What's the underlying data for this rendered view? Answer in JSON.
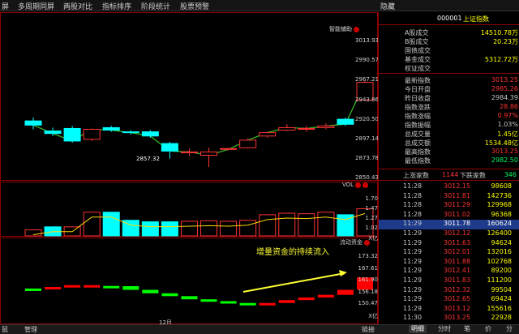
{
  "menu": [
    "屏",
    "多周期同屏",
    "两股对比",
    "指标排序",
    "阶段统计",
    "股票预警"
  ],
  "menu_right": "隐藏",
  "price_axis": [
    "3013.93",
    "2990.57",
    "2967.21",
    "2943.86",
    "2920.50",
    "2897.14",
    "2873.78",
    "2850.43"
  ],
  "low_label": "2857.32",
  "price_panel_title": "智能辅助",
  "vol_panel_title": "VOL",
  "vol_axis": [
    "1.70",
    "1.47",
    "1.27",
    "1.02",
    "X亿"
  ],
  "flow_panel_title": "流动资金",
  "flow_axis": [
    "173.32",
    "167.61",
    "161.90",
    "156.18",
    "150.47",
    "X亿"
  ],
  "annotation": "增量资金的持续流入",
  "x_label": "12月",
  "bottom_tabs": [
    "鼠",
    "管理"
  ],
  "right_tail": "链接",
  "stock_code": "000001",
  "stock_name": "上证指数",
  "info1": [
    {
      "label": "A股成交",
      "value": "14510.78万",
      "color": "#ffff00"
    },
    {
      "label": "B股成交",
      "value": "20.23万",
      "color": "#ffff00"
    },
    {
      "label": "国债成交",
      "value": "",
      "color": "#ffff00"
    },
    {
      "label": "基金成交",
      "value": "5312.72万",
      "color": "#ffff00"
    },
    {
      "label": "权证成交",
      "value": "",
      "color": "#ffff00"
    }
  ],
  "info2": [
    {
      "label": "最新指数",
      "value": "3013.25",
      "color": "#ff3333"
    },
    {
      "label": "今日开盘",
      "value": "2985.26",
      "color": "#ff3333"
    },
    {
      "label": "昨日收盘",
      "value": "2984.39",
      "color": "#c8c8c8"
    },
    {
      "label": "指数涨跌",
      "value": "28.86",
      "color": "#ff3333"
    },
    {
      "label": "指数涨幅",
      "value": "0.97%",
      "color": "#ff3333"
    },
    {
      "label": "指数振幅",
      "value": "1.03%",
      "color": "#c8c8c8"
    },
    {
      "label": "总成交量",
      "value": "1.45亿",
      "color": "#ffff00"
    },
    {
      "label": "总成交额",
      "value": "1534.48亿",
      "color": "#ffff00"
    },
    {
      "label": "最高指数",
      "value": "3013.25",
      "color": "#ff3333"
    },
    {
      "label": "最低指数",
      "value": "2982.50",
      "color": "#00ff66"
    }
  ],
  "breadth": {
    "up_label": "上涨家数",
    "up": "1144",
    "down_label": "下跌家数",
    "down": "346"
  },
  "ticks": [
    {
      "time": "11:28",
      "price": "3012.15",
      "vol": "98608",
      "selected": false
    },
    {
      "time": "11:28",
      "price": "3011.81",
      "vol": "142736",
      "selected": false
    },
    {
      "time": "11:28",
      "price": "3011.29",
      "vol": "129968",
      "selected": false
    },
    {
      "time": "11:28",
      "price": "3011.02",
      "vol": "96368",
      "selected": false
    },
    {
      "time": "11:29",
      "price": "3011.78",
      "vol": "160624",
      "selected": true
    },
    {
      "time": "11:29",
      "price": "3012.12",
      "vol": "126400",
      "selected": false
    },
    {
      "time": "11:29",
      "price": "3011.63",
      "vol": "94624",
      "selected": false
    },
    {
      "time": "11:29",
      "price": "3012.01",
      "vol": "132016",
      "selected": false
    },
    {
      "time": "11:29",
      "price": "3011.88",
      "vol": "102768",
      "selected": false
    },
    {
      "time": "11:29",
      "price": "3012.41",
      "vol": "89200",
      "selected": false
    },
    {
      "time": "11:29",
      "price": "3011.83",
      "vol": "111200",
      "selected": false
    },
    {
      "time": "11:29",
      "price": "3012.32",
      "vol": "99504",
      "selected": false
    },
    {
      "time": "11:29",
      "price": "3012.65",
      "vol": "69424",
      "selected": false
    },
    {
      "time": "11:29",
      "price": "3013.12",
      "vol": "155616",
      "selected": false
    },
    {
      "time": "11:30",
      "price": "3013.25",
      "vol": "22928",
      "selected": false
    }
  ],
  "rp_tabs": [
    "明细",
    "分时",
    "笔",
    "价",
    "分"
  ],
  "chart_data": {
    "type": "candlestick",
    "candles": [
      {
        "o": 2918,
        "c": 2913,
        "h": 2922,
        "l": 2908,
        "up": false
      },
      {
        "o": 2906,
        "c": 2903,
        "h": 2910,
        "l": 2900,
        "up": false
      },
      {
        "o": 2909,
        "c": 2894,
        "h": 2912,
        "l": 2892,
        "up": false
      },
      {
        "o": 2896,
        "c": 2908,
        "h": 2909,
        "l": 2894,
        "up": true
      },
      {
        "o": 2910,
        "c": 2907,
        "h": 2912,
        "l": 2905,
        "up": false
      },
      {
        "o": 2905,
        "c": 2904,
        "h": 2907,
        "l": 2902,
        "up": false
      },
      {
        "o": 2905,
        "c": 2900,
        "h": 2907,
        "l": 2898,
        "up": false
      },
      {
        "o": 2891,
        "c": 2882,
        "h": 2893,
        "l": 2873,
        "up": false
      },
      {
        "o": 2880,
        "c": 2881,
        "h": 2885,
        "l": 2876,
        "up": true
      },
      {
        "o": 2881,
        "c": 2877,
        "h": 2886,
        "l": 2863,
        "up": true
      },
      {
        "o": 2885,
        "c": 2884,
        "h": 2886,
        "l": 2883,
        "up": true
      },
      {
        "o": 2886,
        "c": 2895,
        "h": 2897,
        "l": 2885,
        "up": true
      },
      {
        "o": 2900,
        "c": 2904,
        "h": 2905,
        "l": 2898,
        "up": true
      },
      {
        "o": 2907,
        "c": 2910,
        "h": 2914,
        "l": 2906,
        "up": true
      },
      {
        "o": 2908,
        "c": 2909,
        "h": 2912,
        "l": 2905,
        "up": true
      },
      {
        "o": 2910,
        "c": 2912,
        "h": 2915,
        "l": 2908,
        "up": true
      },
      {
        "o": 2920,
        "c": 2914,
        "h": 2922,
        "l": 2912,
        "up": false
      },
      {
        "o": 2943,
        "c": 2964,
        "h": 2966,
        "l": 2942,
        "up": true
      }
    ],
    "volumes": [
      {
        "v": 1.08,
        "up": true
      },
      {
        "v": 1.14,
        "up": false
      },
      {
        "v": 1.14,
        "up": true
      },
      {
        "v": 1.43,
        "up": true
      },
      {
        "v": 1.43,
        "up": false
      },
      {
        "v": 1.27,
        "up": false
      },
      {
        "v": 1.24,
        "up": false
      },
      {
        "v": 1.24,
        "up": false
      },
      {
        "v": 1.25,
        "up": true
      },
      {
        "v": 1.26,
        "up": true
      },
      {
        "v": 1.25,
        "up": true
      },
      {
        "v": 1.27,
        "up": true
      },
      {
        "v": 1.38,
        "up": true
      },
      {
        "v": 1.41,
        "up": true
      },
      {
        "v": 1.4,
        "up": true
      },
      {
        "v": 1.43,
        "up": true
      },
      {
        "v": 1.38,
        "up": false
      },
      {
        "v": 1.5,
        "up": true
      }
    ],
    "flows": [
      {
        "v": 161.3,
        "up": false
      },
      {
        "v": 161.9,
        "up": true
      },
      {
        "v": 162.6,
        "up": true
      },
      {
        "v": 162.3,
        "up": true
      },
      {
        "v": 162.2,
        "up": false
      },
      {
        "v": 160.8,
        "up": false
      },
      {
        "v": 159.5,
        "up": false
      },
      {
        "v": 158.4,
        "up": false
      },
      {
        "v": 157.2,
        "up": false
      },
      {
        "v": 156.5,
        "up": false
      },
      {
        "v": 155.8,
        "up": false
      },
      {
        "v": 155.7,
        "up": false
      },
      {
        "v": 155.8,
        "up": true
      },
      {
        "v": 156.9,
        "up": true
      },
      {
        "v": 157.9,
        "up": true
      },
      {
        "v": 158.9,
        "up": true
      },
      {
        "v": 160.8,
        "up": true
      },
      {
        "v": 165.5,
        "up": true
      }
    ]
  }
}
